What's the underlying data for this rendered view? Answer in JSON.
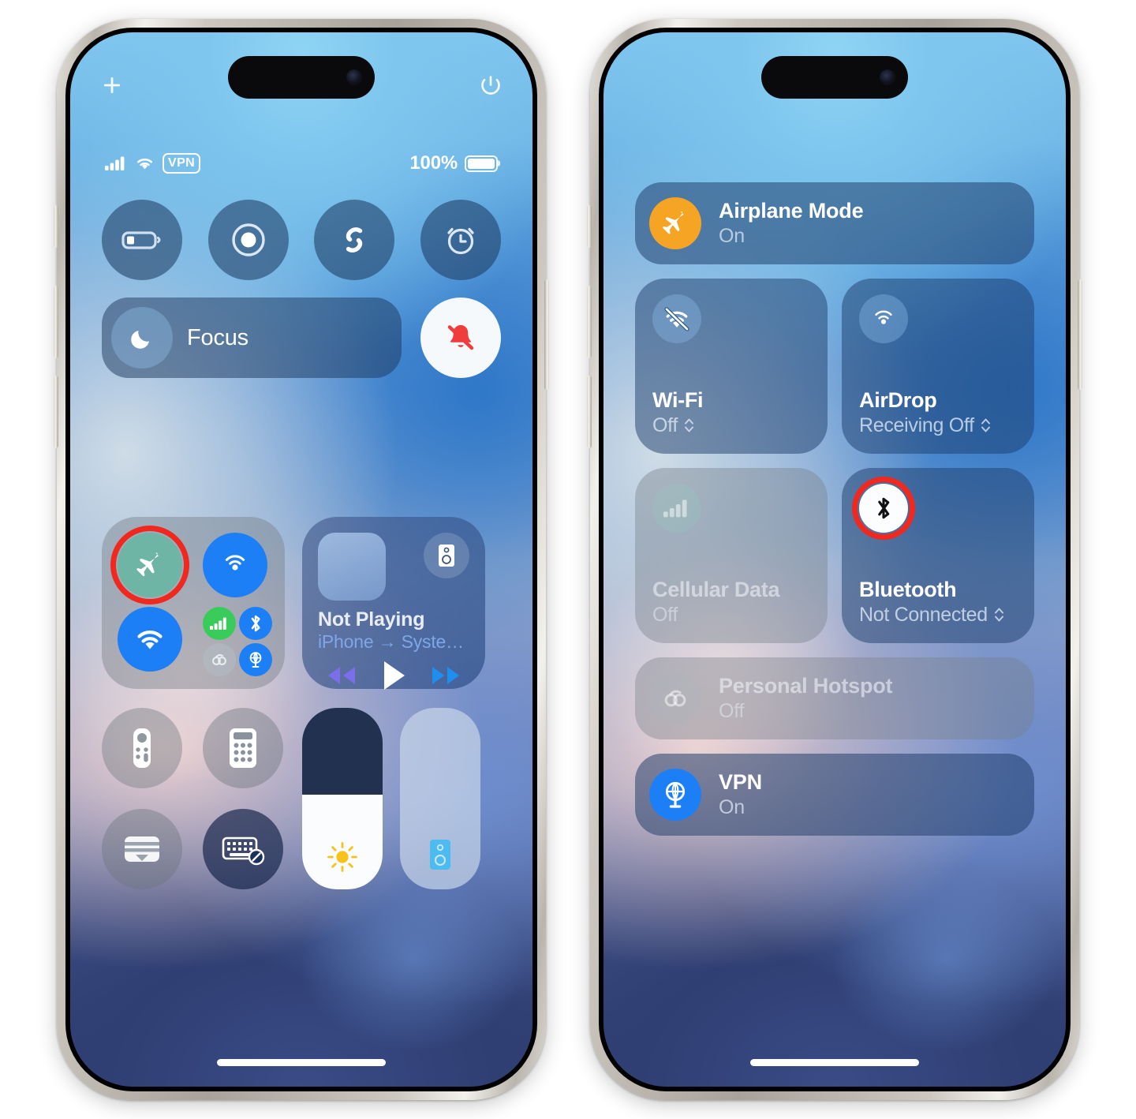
{
  "colors": {
    "accent_blue": "#1c7ff5",
    "highlight_red": "#f0281e",
    "airplane_orange": "#f5a423",
    "cellular_green": "#3acc5b",
    "focus_moon": "#ffffff",
    "silent_red": "#f03c3c",
    "brightness_yellow": "#f7c31b",
    "volume_blue": "#4cbcf0",
    "airplane_toggle_teal": "#6fb5a5"
  },
  "phone_left": {
    "corner_icons": {
      "add": "plus-icon",
      "power": "power-icon"
    },
    "status_bar": {
      "cellular": "cellular-bars-icon",
      "wifi": "wifi-icon",
      "vpn_badge": "VPN",
      "battery_percent": "100%",
      "battery": "battery-full-icon"
    },
    "top_circle_controls": [
      {
        "name": "low-power-mode",
        "icon": "battery-low-icon"
      },
      {
        "name": "screen-record",
        "icon": "record-icon"
      },
      {
        "name": "shazam",
        "icon": "shazam-icon"
      },
      {
        "name": "alarm",
        "icon": "alarm-clock-icon"
      }
    ],
    "focus": {
      "label": "Focus",
      "icon": "moon-icon"
    },
    "silent_mode": {
      "name": "silent-mode",
      "icon": "bell-slash-icon",
      "state": "on"
    },
    "connectivity_module": {
      "airplane": {
        "label": "Airplane Mode",
        "state": "on",
        "icon": "airplane-icon",
        "highlighted": true
      },
      "airdrop": {
        "label": "AirDrop",
        "state": "on",
        "icon": "airdrop-icon"
      },
      "wifi": {
        "label": "Wi-Fi",
        "state": "on",
        "icon": "wifi-icon"
      },
      "cellular": {
        "label": "Cellular Data",
        "state": "on",
        "icon": "cellular-bars-icon"
      },
      "bluetooth": {
        "label": "Bluetooth",
        "state": "on",
        "icon": "bluetooth-icon"
      },
      "hotspot": {
        "label": "Personal Hotspot",
        "state": "off",
        "icon": "hotspot-icon"
      },
      "vpn": {
        "label": "VPN",
        "state": "on",
        "icon": "vpn-globe-icon"
      }
    },
    "media": {
      "title": "Not Playing",
      "route": "iPhone → Syste…",
      "airplay_icon": "airplay-speaker-icon",
      "controls": {
        "rewind": "rewind-icon",
        "play": "play-icon",
        "forward": "fast-forward-icon"
      }
    },
    "bottom_tiles": [
      {
        "name": "apple-tv-remote",
        "icon": "remote-icon"
      },
      {
        "name": "calculator",
        "icon": "calculator-icon"
      },
      {
        "name": "wallet",
        "icon": "wallet-icon"
      },
      {
        "name": "keyboard-accessibility",
        "icon": "keyboard-slash-icon"
      }
    ],
    "sliders": {
      "brightness": {
        "name": "brightness-slider",
        "icon": "sun-icon",
        "level": 52
      },
      "volume": {
        "name": "volume-slider",
        "icon": "speaker-icon",
        "level": 100
      }
    }
  },
  "phone_right": {
    "connectivity_panel": {
      "airplane_mode": {
        "title": "Airplane Mode",
        "status": "On",
        "icon": "airplane-icon",
        "enabled": true
      },
      "wifi": {
        "title": "Wi-Fi",
        "status": "Off",
        "icon": "wifi-slash-icon",
        "chevron": true
      },
      "airdrop": {
        "title": "AirDrop",
        "status": "Receiving Off",
        "icon": "airdrop-icon",
        "chevron": true
      },
      "cellular": {
        "title": "Cellular Data",
        "status": "Off",
        "icon": "cellular-bars-icon",
        "dimmed": true
      },
      "bluetooth": {
        "title": "Bluetooth",
        "status": "Not Connected",
        "icon": "bluetooth-icon",
        "chevron": true,
        "highlighted": true
      },
      "hotspot": {
        "title": "Personal Hotspot",
        "status": "Off",
        "icon": "hotspot-icon",
        "dimmed": true
      },
      "vpn": {
        "title": "VPN",
        "status": "On",
        "icon": "vpn-globe-icon",
        "enabled": true
      }
    }
  }
}
